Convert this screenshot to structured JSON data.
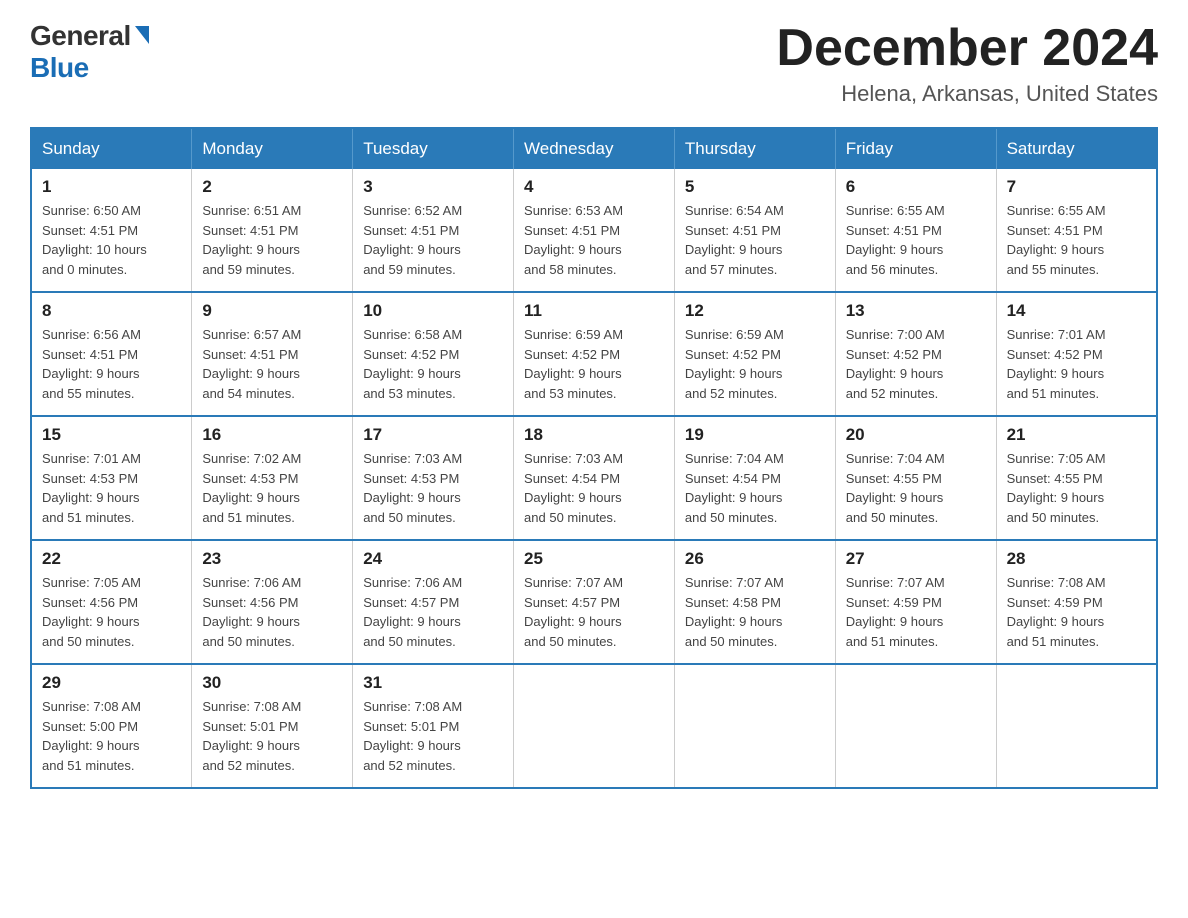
{
  "header": {
    "logo_general": "General",
    "logo_blue": "Blue",
    "month_title": "December 2024",
    "location": "Helena, Arkansas, United States"
  },
  "weekdays": [
    "Sunday",
    "Monday",
    "Tuesday",
    "Wednesday",
    "Thursday",
    "Friday",
    "Saturday"
  ],
  "weeks": [
    [
      {
        "day": "1",
        "sunrise": "6:50 AM",
        "sunset": "4:51 PM",
        "daylight": "10 hours and 0 minutes."
      },
      {
        "day": "2",
        "sunrise": "6:51 AM",
        "sunset": "4:51 PM",
        "daylight": "9 hours and 59 minutes."
      },
      {
        "day": "3",
        "sunrise": "6:52 AM",
        "sunset": "4:51 PM",
        "daylight": "9 hours and 59 minutes."
      },
      {
        "day": "4",
        "sunrise": "6:53 AM",
        "sunset": "4:51 PM",
        "daylight": "9 hours and 58 minutes."
      },
      {
        "day": "5",
        "sunrise": "6:54 AM",
        "sunset": "4:51 PM",
        "daylight": "9 hours and 57 minutes."
      },
      {
        "day": "6",
        "sunrise": "6:55 AM",
        "sunset": "4:51 PM",
        "daylight": "9 hours and 56 minutes."
      },
      {
        "day": "7",
        "sunrise": "6:55 AM",
        "sunset": "4:51 PM",
        "daylight": "9 hours and 55 minutes."
      }
    ],
    [
      {
        "day": "8",
        "sunrise": "6:56 AM",
        "sunset": "4:51 PM",
        "daylight": "9 hours and 55 minutes."
      },
      {
        "day": "9",
        "sunrise": "6:57 AM",
        "sunset": "4:51 PM",
        "daylight": "9 hours and 54 minutes."
      },
      {
        "day": "10",
        "sunrise": "6:58 AM",
        "sunset": "4:52 PM",
        "daylight": "9 hours and 53 minutes."
      },
      {
        "day": "11",
        "sunrise": "6:59 AM",
        "sunset": "4:52 PM",
        "daylight": "9 hours and 53 minutes."
      },
      {
        "day": "12",
        "sunrise": "6:59 AM",
        "sunset": "4:52 PM",
        "daylight": "9 hours and 52 minutes."
      },
      {
        "day": "13",
        "sunrise": "7:00 AM",
        "sunset": "4:52 PM",
        "daylight": "9 hours and 52 minutes."
      },
      {
        "day": "14",
        "sunrise": "7:01 AM",
        "sunset": "4:52 PM",
        "daylight": "9 hours and 51 minutes."
      }
    ],
    [
      {
        "day": "15",
        "sunrise": "7:01 AM",
        "sunset": "4:53 PM",
        "daylight": "9 hours and 51 minutes."
      },
      {
        "day": "16",
        "sunrise": "7:02 AM",
        "sunset": "4:53 PM",
        "daylight": "9 hours and 51 minutes."
      },
      {
        "day": "17",
        "sunrise": "7:03 AM",
        "sunset": "4:53 PM",
        "daylight": "9 hours and 50 minutes."
      },
      {
        "day": "18",
        "sunrise": "7:03 AM",
        "sunset": "4:54 PM",
        "daylight": "9 hours and 50 minutes."
      },
      {
        "day": "19",
        "sunrise": "7:04 AM",
        "sunset": "4:54 PM",
        "daylight": "9 hours and 50 minutes."
      },
      {
        "day": "20",
        "sunrise": "7:04 AM",
        "sunset": "4:55 PM",
        "daylight": "9 hours and 50 minutes."
      },
      {
        "day": "21",
        "sunrise": "7:05 AM",
        "sunset": "4:55 PM",
        "daylight": "9 hours and 50 minutes."
      }
    ],
    [
      {
        "day": "22",
        "sunrise": "7:05 AM",
        "sunset": "4:56 PM",
        "daylight": "9 hours and 50 minutes."
      },
      {
        "day": "23",
        "sunrise": "7:06 AM",
        "sunset": "4:56 PM",
        "daylight": "9 hours and 50 minutes."
      },
      {
        "day": "24",
        "sunrise": "7:06 AM",
        "sunset": "4:57 PM",
        "daylight": "9 hours and 50 minutes."
      },
      {
        "day": "25",
        "sunrise": "7:07 AM",
        "sunset": "4:57 PM",
        "daylight": "9 hours and 50 minutes."
      },
      {
        "day": "26",
        "sunrise": "7:07 AM",
        "sunset": "4:58 PM",
        "daylight": "9 hours and 50 minutes."
      },
      {
        "day": "27",
        "sunrise": "7:07 AM",
        "sunset": "4:59 PM",
        "daylight": "9 hours and 51 minutes."
      },
      {
        "day": "28",
        "sunrise": "7:08 AM",
        "sunset": "4:59 PM",
        "daylight": "9 hours and 51 minutes."
      }
    ],
    [
      {
        "day": "29",
        "sunrise": "7:08 AM",
        "sunset": "5:00 PM",
        "daylight": "9 hours and 51 minutes."
      },
      {
        "day": "30",
        "sunrise": "7:08 AM",
        "sunset": "5:01 PM",
        "daylight": "9 hours and 52 minutes."
      },
      {
        "day": "31",
        "sunrise": "7:08 AM",
        "sunset": "5:01 PM",
        "daylight": "9 hours and 52 minutes."
      },
      null,
      null,
      null,
      null
    ]
  ],
  "labels": {
    "sunrise": "Sunrise:",
    "sunset": "Sunset:",
    "daylight": "Daylight:"
  }
}
